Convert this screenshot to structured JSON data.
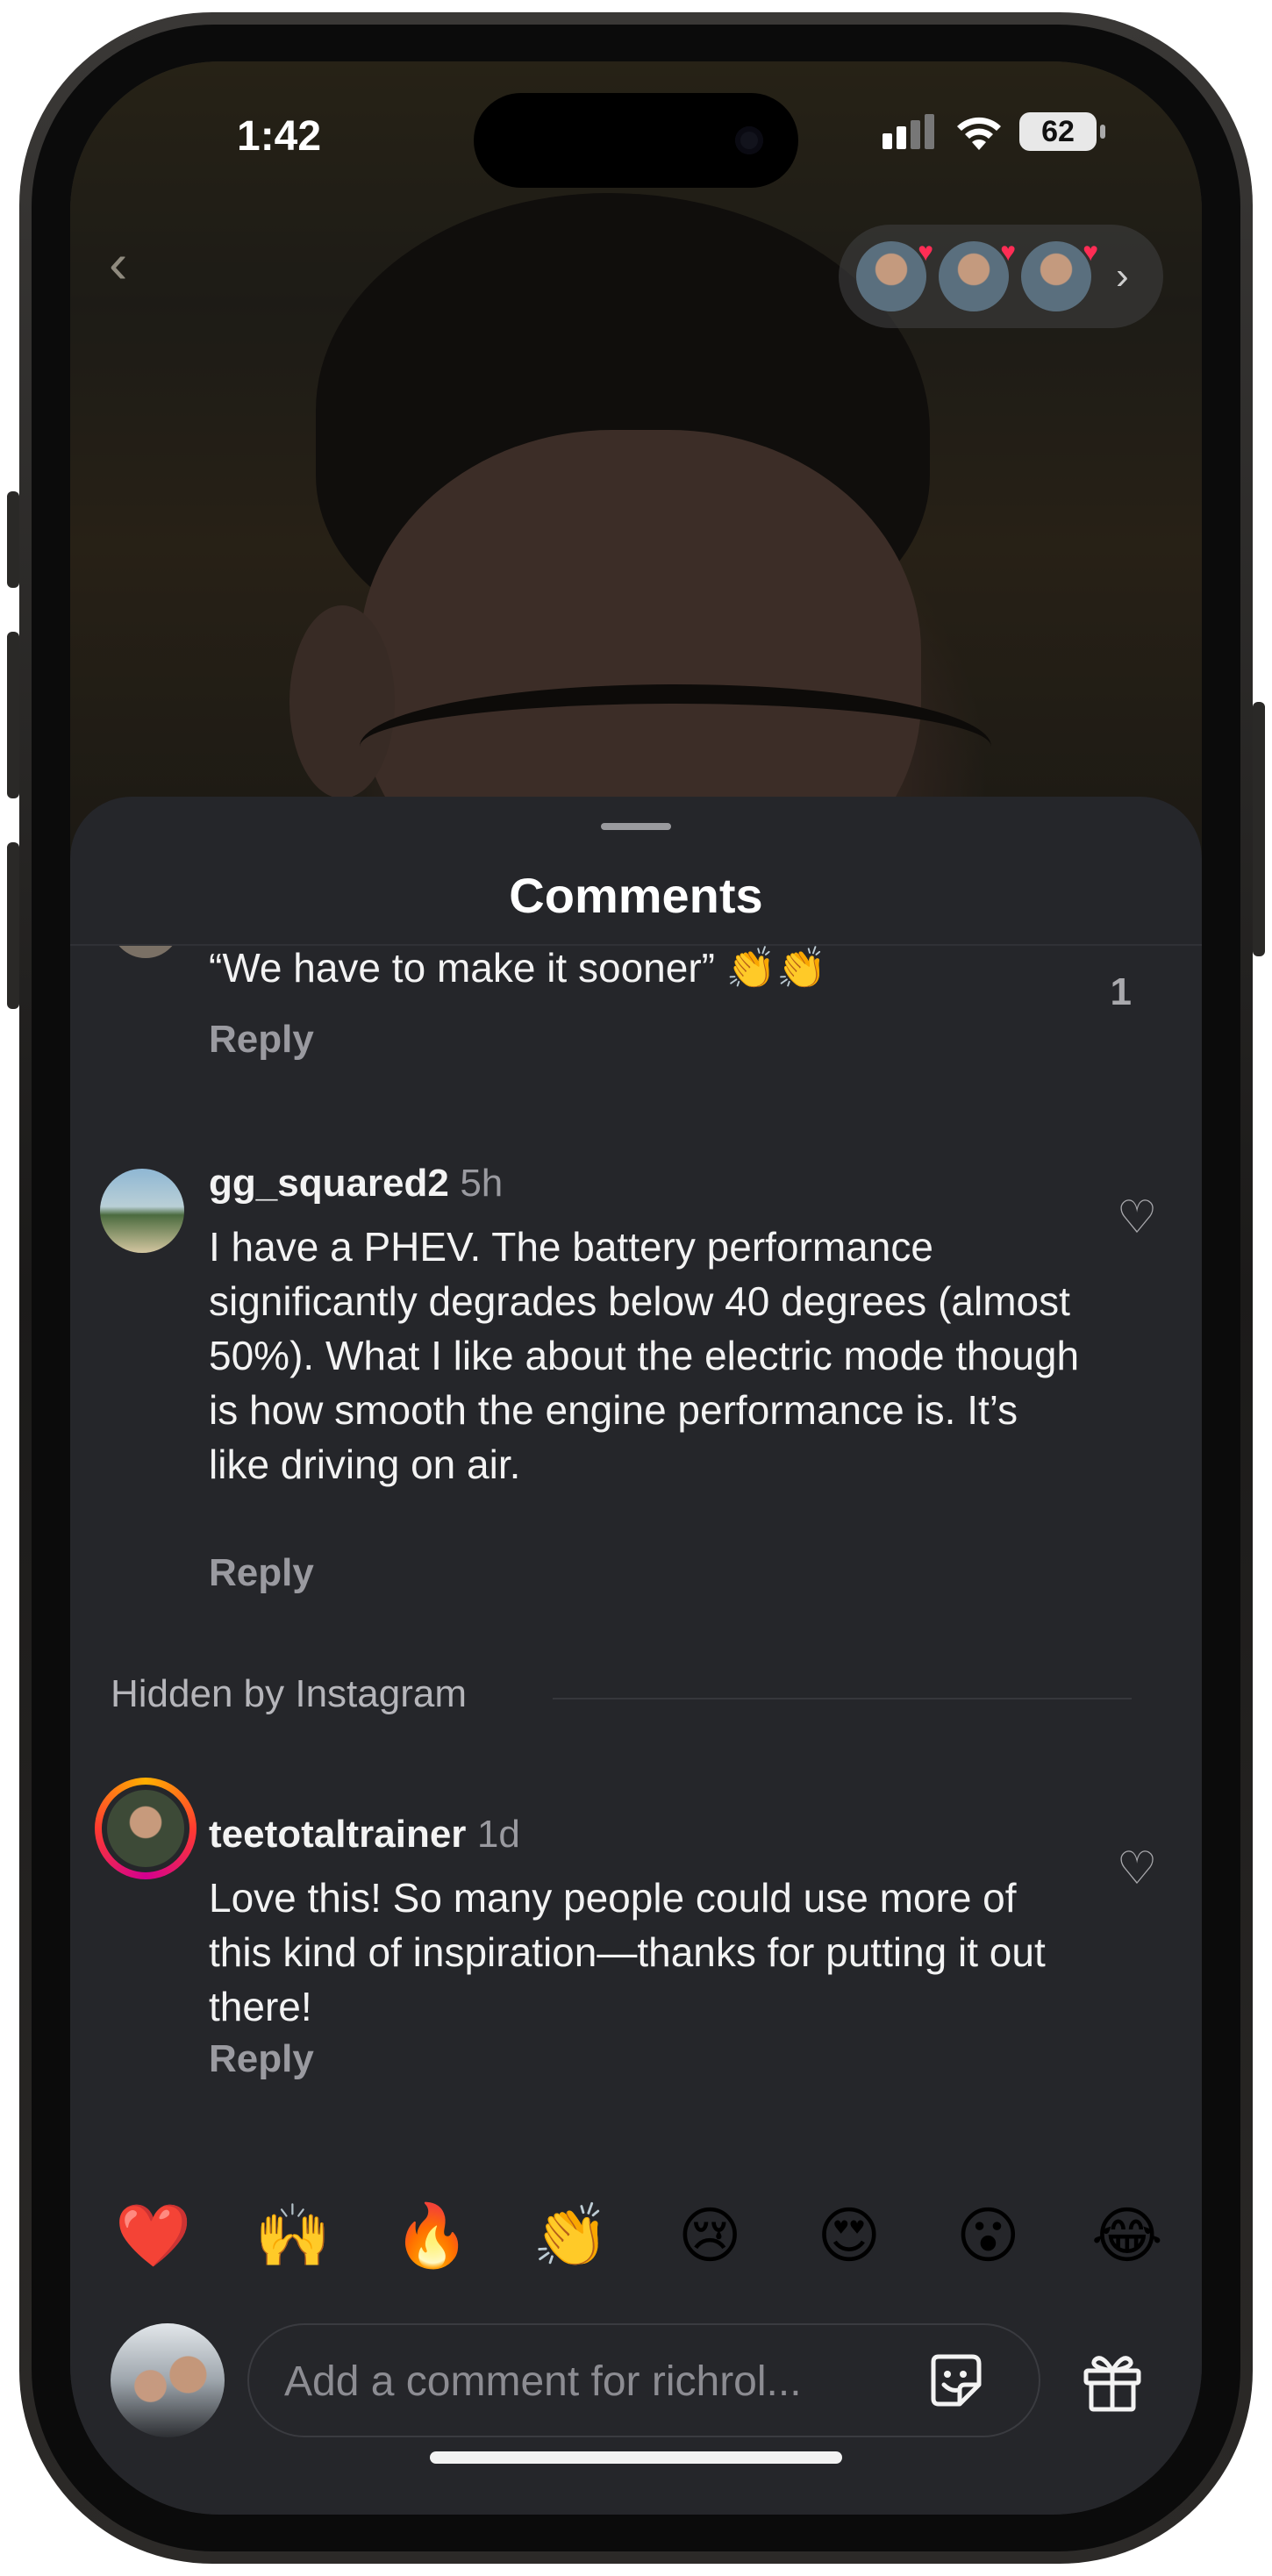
{
  "status_bar": {
    "time": "1:42",
    "battery": "62"
  },
  "sheet": {
    "title": "Comments"
  },
  "comments": [
    {
      "text": "“We have to make it sooner” 👏👏",
      "reply_label": "Reply",
      "like_count": "1"
    },
    {
      "username": "gg_squared2",
      "time": "5h",
      "text": "I have a PHEV. The battery performance significantly degrades below 40 degrees (almost 50%). What I like about the electric mode though is how smooth the engine performance is.  It’s like driving on air.",
      "reply_label": "Reply"
    },
    {
      "username": "teetotaltrainer",
      "time": "1d",
      "text": "Love this! So many people could use more of this kind of inspiration—thanks for putting it out there!",
      "reply_label": "Reply"
    }
  ],
  "hidden_section": {
    "label": "Hidden by Instagram"
  },
  "emoji_bar": [
    "❤️",
    "🙌",
    "🔥",
    "👏",
    "😢",
    "😍",
    "😮",
    "😂"
  ],
  "composer": {
    "placeholder": "Add a comment for richrol..."
  },
  "icons": {
    "back": "chevron-left-icon",
    "like": "heart-outline-icon",
    "sticker": "sticker-icon",
    "gift": "gift-icon"
  },
  "colors": {
    "sheet_background": "#25262a",
    "text_primary": "#f3f3f3",
    "text_secondary": "#9a9aa0",
    "story_ring": "#d3008f"
  }
}
